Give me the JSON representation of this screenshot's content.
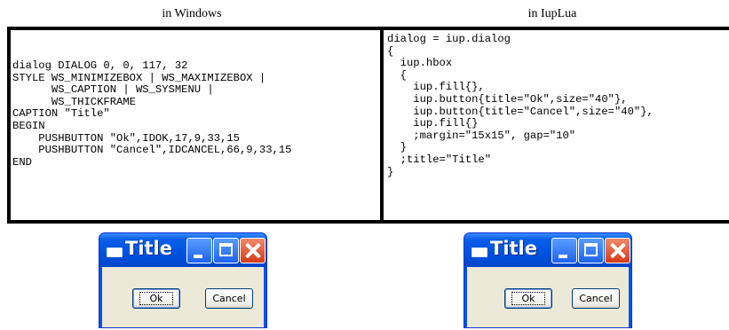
{
  "headings": {
    "left": "in Windows",
    "right": "in IupLua"
  },
  "code": {
    "windows": "dialog DIALOG 0, 0, 117, 32\nSTYLE WS_MINIMIZEBOX | WS_MAXIMIZEBOX |\n      WS_CAPTION | WS_SYSMENU |\n      WS_THICKFRAME\nCAPTION \"Title\"\nBEGIN\n    PUSHBUTTON \"Ok\",IDOK,17,9,33,15\n    PUSHBUTTON \"Cancel\",IDCANCEL,66,9,33,15\nEND",
    "iuplua": "dialog = iup.dialog\n{\n  iup.hbox\n  {\n    iup.fill{},\n    iup.button{title=\"Ok\",size=\"40\"},\n    iup.button{title=\"Cancel\",size=\"40\"},\n    iup.fill{}\n    ;margin=\"15x15\", gap=\"10\"\n  }\n  ;title=\"Title\"\n}"
  },
  "windows_dialog": {
    "title": "Title",
    "ok_label": "Ok",
    "cancel_label": "Cancel"
  },
  "iuplua_dialog": {
    "title": "Title",
    "ok_label": "Ok",
    "cancel_label": "Cancel"
  },
  "icons": [
    "window-icon",
    "minimize-icon",
    "maximize-icon",
    "close-icon"
  ],
  "colors": {
    "titlebar": "#0055e5",
    "close_button": "#d43a18",
    "client_area": "#ece9d8"
  }
}
